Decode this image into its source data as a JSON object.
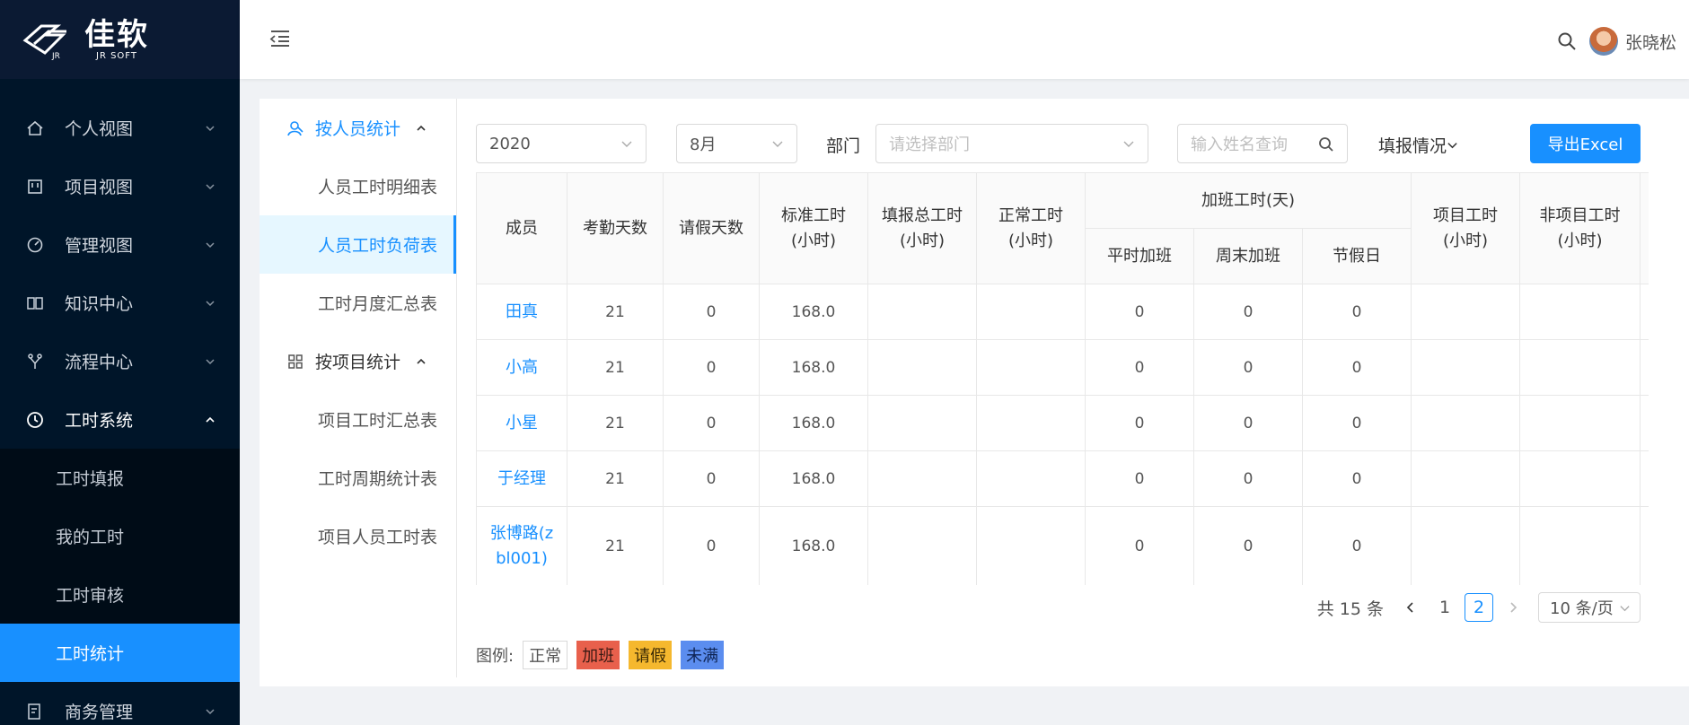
{
  "brand": {
    "name": "佳软",
    "sub": "JR SOFT",
    "mark": "JR"
  },
  "sidebar": {
    "menu": [
      {
        "label": "个人视图",
        "icon": "home-icon"
      },
      {
        "label": "项目视图",
        "icon": "project-icon"
      },
      {
        "label": "管理视图",
        "icon": "dashboard-icon"
      },
      {
        "label": "知识中心",
        "icon": "book-icon"
      },
      {
        "label": "流程中心",
        "icon": "branch-icon"
      },
      {
        "label": "工时系统",
        "icon": "clock-icon"
      }
    ],
    "submenu": [
      "工时填报",
      "我的工时",
      "工时审核",
      "工时统计"
    ],
    "after": {
      "label": "商务管理",
      "icon": "contract-icon"
    }
  },
  "header": {
    "user": "张晓松"
  },
  "subnav": {
    "group1": "按人员统计",
    "group1_items": [
      "人员工时明细表",
      "人员工时负荷表",
      "工时月度汇总表"
    ],
    "group2": "按项目统计",
    "group2_items": [
      "项目工时汇总表",
      "工时周期统计表",
      "项目人员工时表"
    ]
  },
  "filters": {
    "year": "2020",
    "month": "8月",
    "dept_label": "部门",
    "dept_placeholder": "请选择部门",
    "name_placeholder": "输入姓名查询",
    "fill_status": "填报情况",
    "export": "导出Excel"
  },
  "table": {
    "headers": {
      "member": "成员",
      "attend": "考勤天数",
      "leave": "请假天数",
      "standard": "标准工时",
      "filled": "填报总工时",
      "normal": "正常工时",
      "overtime": "加班工时(天)",
      "weekday": "平时加班",
      "weekend": "周末加班",
      "holiday": "节假日",
      "project": "项目工时",
      "nonproject": "非项目工时",
      "unit": "(小时)"
    },
    "rows": [
      {
        "name": "田真",
        "attend": "21",
        "leave": "0",
        "standard": "168.0",
        "weekday": "0",
        "weekend": "0",
        "holiday": "0"
      },
      {
        "name": "小高",
        "attend": "21",
        "leave": "0",
        "standard": "168.0",
        "weekday": "0",
        "weekend": "0",
        "holiday": "0"
      },
      {
        "name": "小星",
        "attend": "21",
        "leave": "0",
        "standard": "168.0",
        "weekday": "0",
        "weekend": "0",
        "holiday": "0"
      },
      {
        "name": "于经理",
        "attend": "21",
        "leave": "0",
        "standard": "168.0",
        "weekday": "0",
        "weekend": "0",
        "holiday": "0"
      },
      {
        "name": "张博路(z",
        "name2": "bl001)",
        "attend": "21",
        "leave": "0",
        "standard": "168.0",
        "weekday": "0",
        "weekend": "0",
        "holiday": "0"
      }
    ]
  },
  "pager": {
    "total": "共 15 条",
    "pages": [
      "1",
      "2"
    ],
    "current": "2",
    "size": "10 条/页"
  },
  "legend": {
    "label": "图例:",
    "items": [
      {
        "label": "正常",
        "color": "#ffffff"
      },
      {
        "label": "加班",
        "color": "#e8604c"
      },
      {
        "label": "请假",
        "color": "#f5b82e"
      },
      {
        "label": "未满",
        "color": "#5b8def"
      }
    ]
  },
  "colors": {
    "primary": "#1890ff",
    "sidebar": "#001529"
  }
}
